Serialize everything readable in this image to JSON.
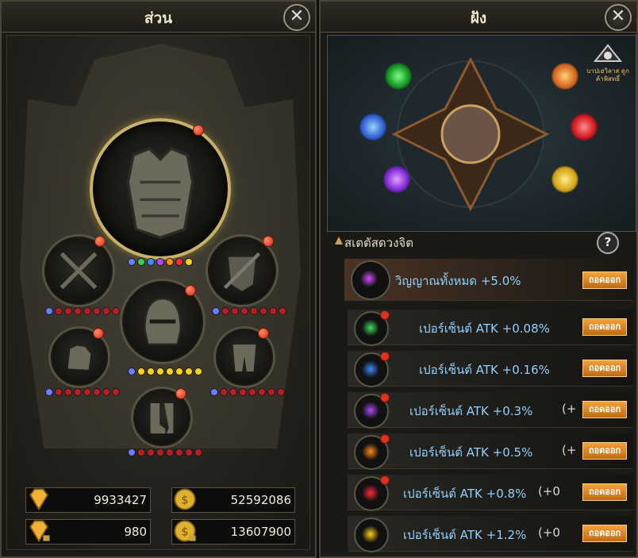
{
  "left_panel": {
    "title": "ส่วน",
    "resources": [
      {
        "icon": "diamond-icon",
        "value": "9933427"
      },
      {
        "icon": "gold-coin-icon",
        "value": "52592086"
      },
      {
        "icon": "bound-diamond-icon",
        "value": "980"
      },
      {
        "icon": "bound-gold-coin-icon",
        "value": "13607900"
      }
    ]
  },
  "right_panel": {
    "title": "ฝัง",
    "badge_text": "บาปเฮวิลาส ดูกค้าพิสทธิ์",
    "section_title": "สเตตัสดวงจิต",
    "help_label": "?",
    "rows": [
      {
        "text": "วิญญาณทั้งหมด +5.0%",
        "extra": "",
        "button": "ถอดออก",
        "color": "#d84aff"
      },
      {
        "text": "เปอร์เซ็นต์ ATK +0.08%",
        "extra": "",
        "button": "ถอดออก",
        "color": "#3ee05a"
      },
      {
        "text": "เปอร์เซ็นต์ ATK +0.16%",
        "extra": "",
        "button": "ถอดออก",
        "color": "#3a8cff"
      },
      {
        "text": "เปอร์เซ็นต์ ATK +0.3%",
        "extra": "(+",
        "button": "ถอดออก",
        "color": "#b048ff"
      },
      {
        "text": "เปอร์เซ็นต์ ATK +0.5%",
        "extra": "(+",
        "button": "ถอดออก",
        "color": "#ff8a1a"
      },
      {
        "text": "เปอร์เซ็นต์ ATK +0.8%",
        "extra": "(+0",
        "button": "ถอดออก",
        "color": "#ff2a3a"
      },
      {
        "text": "เปอร์เซ็นต์ ATK +1.2%",
        "extra": "(+0",
        "button": "ถอดออก",
        "color": "#ffd21a"
      }
    ]
  },
  "colors": {
    "accent_gold": "#c9b16a",
    "button_orange": "#e0861e",
    "stat_text": "#8fd0ff"
  }
}
